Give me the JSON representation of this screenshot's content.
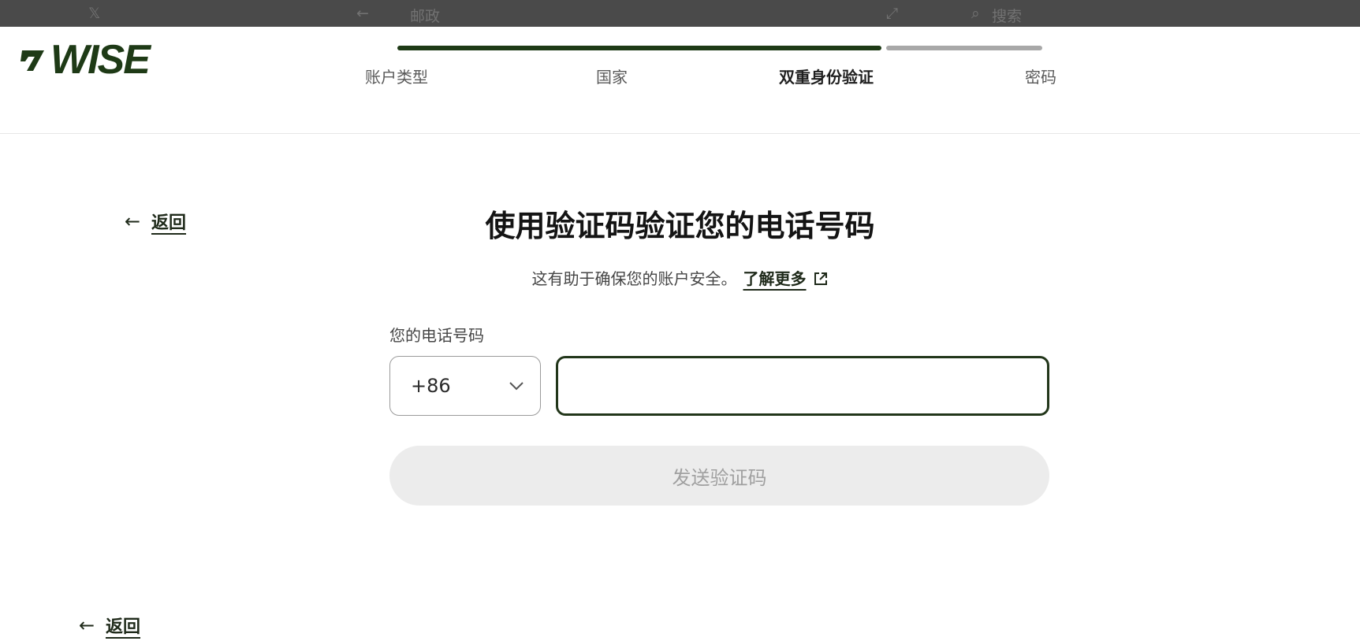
{
  "browser_bar": {
    "nav_title": "邮政",
    "search_placeholder": "搜索"
  },
  "brand": {
    "name": "WISE",
    "color": "#1e3a16"
  },
  "progress": {
    "completed_fraction": 0.75,
    "active_color": "#1e3a16",
    "inactive_color": "#a8a8a8",
    "steps": [
      {
        "label": "账户类型",
        "state": "done"
      },
      {
        "label": "国家",
        "state": "done"
      },
      {
        "label": "双重身份验证",
        "state": "active"
      },
      {
        "label": "密码",
        "state": "pending"
      }
    ]
  },
  "back_top": {
    "label": "返回"
  },
  "back_bottom": {
    "label": "返回"
  },
  "main": {
    "title": "使用验证码验证您的电话号码",
    "subtitle": "这有助于确保您的账户安全。",
    "learn_more": "了解更多",
    "phone_label": "您的电话号码",
    "country_code": "+86",
    "phone_value": "",
    "send_button": "发送验证码"
  }
}
